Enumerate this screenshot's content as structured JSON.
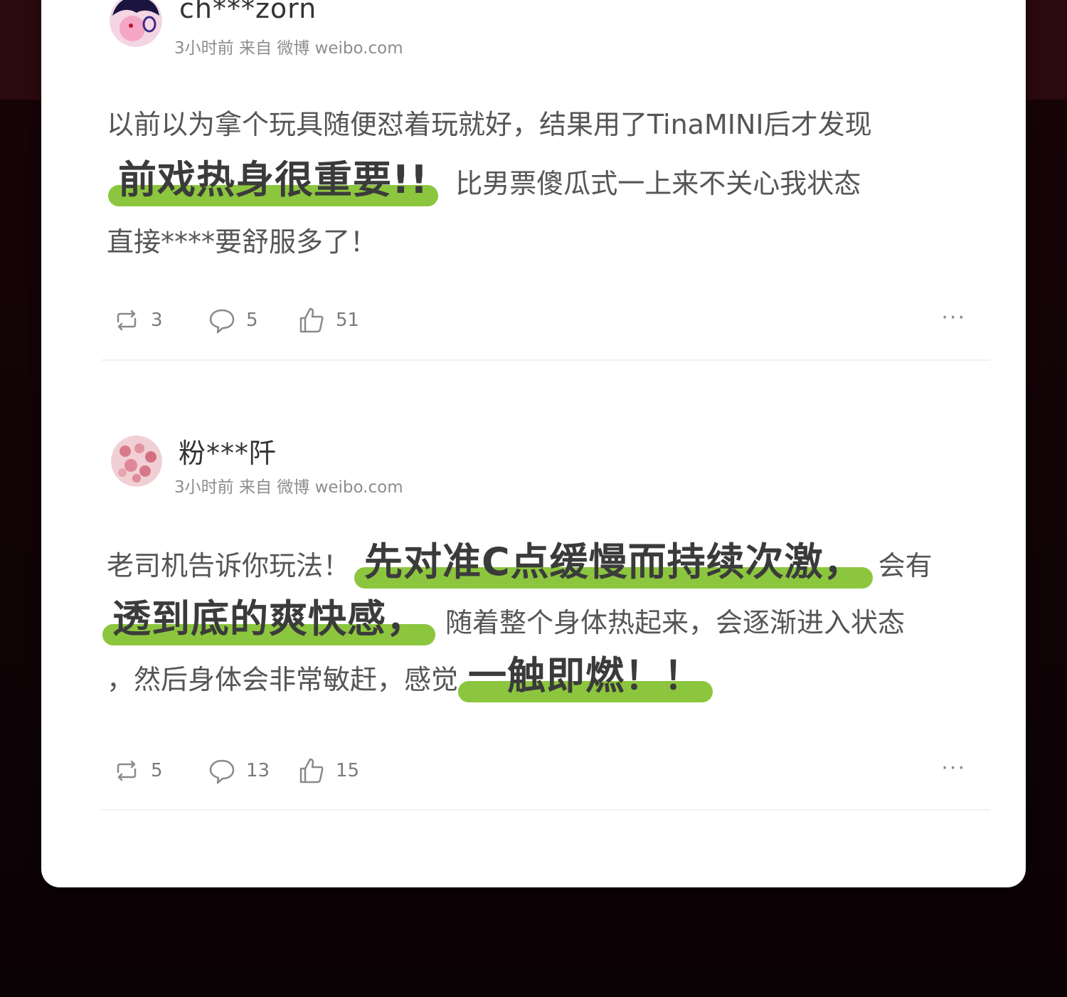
{
  "posts": [
    {
      "username": "ch***zorn",
      "meta": "3小时前 来自 微博 weibo.com",
      "line1": "以前以为拿个玩具随便怼着玩就好，结果用了TinaMINI后才发现",
      "line2_highlight": "前戏热身很重要!!",
      "line2_text": "比男票傻瓜式一上来不关心我状态",
      "line3": "直接****要舒服多了！",
      "actions": {
        "repost": "3",
        "comment": "5",
        "like": "51",
        "more": "···"
      }
    },
    {
      "username": "粉***阡",
      "meta": "3小时前 来自 微博 weibo.com",
      "line1_text": "老司机告诉你玩法！",
      "line1_highlight": "先对准C点缓慢而持续次激，",
      "line1_tail": "会有",
      "line2_highlight": "透到底的爽快感，",
      "line2_text": "随着整个身体热起来，会逐渐进入状态",
      "line3_text": "，然后身体会非常敏赶，感觉",
      "line3_highlight": "一触即燃！！",
      "actions": {
        "repost": "5",
        "comment": "13",
        "like": "15",
        "more": "···"
      }
    }
  ],
  "colors": {
    "highlight": "#8cc63f",
    "background": "#0e0306",
    "card": "#ffffff"
  }
}
